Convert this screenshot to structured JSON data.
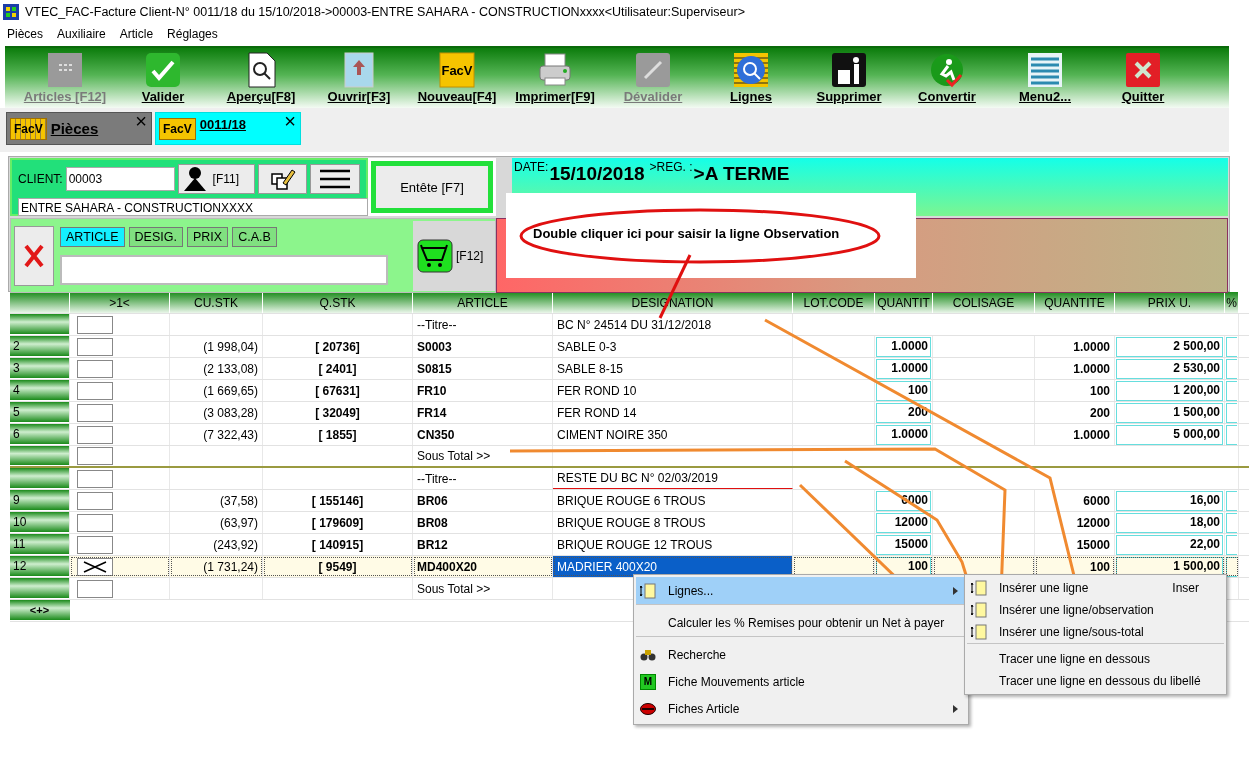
{
  "window": {
    "title": "VTEC_FAC-Facture Client-N° 0011/18 du 15/10/2018->00003-ENTRE SAHARA - CONSTRUCTIONxxxx<Utilisateur:Superviseur>"
  },
  "menu_bar": [
    "Pièces",
    "Auxiliaire",
    "Article",
    "Réglages"
  ],
  "toolbar": [
    {
      "label": "Articles [F12]",
      "disabled": true
    },
    {
      "label": "Valider",
      "disabled": false
    },
    {
      "label": "Aperçu[F8]",
      "disabled": false
    },
    {
      "label": "Ouvrir[F3]",
      "disabled": false
    },
    {
      "label": "Nouveau[F4]",
      "disabled": false,
      "icon_text": "FacV"
    },
    {
      "label": "Imprimer[F9]",
      "disabled": false
    },
    {
      "label": "Dévalider",
      "disabled": true
    },
    {
      "label": "Lignes",
      "disabled": false
    },
    {
      "label": "Supprimer",
      "disabled": false
    },
    {
      "label": "Convertir",
      "disabled": false
    },
    {
      "label": "Menu2...",
      "disabled": false
    },
    {
      "label": "Quitter",
      "disabled": false
    }
  ],
  "tabs": [
    {
      "label": "Pièces",
      "icon_text": "FacV",
      "close": "×",
      "selected": false
    },
    {
      "label": "0011/18",
      "icon_text": "FacV",
      "close": "×",
      "selected": true
    }
  ],
  "client": {
    "label": "CLIENT:",
    "code": "00003",
    "person_shortcut": "[F11]",
    "name": "ENTRE SAHARA - CONSTRUCTIONXXXX",
    "header_button": "Entête [F7]"
  },
  "search": {
    "modes": [
      {
        "label": "ARTICLE",
        "selected": true
      },
      {
        "label": "DESIG.",
        "selected": false
      },
      {
        "label": "PRIX",
        "selected": false
      },
      {
        "label": "C.A.B",
        "selected": false
      }
    ],
    "cart_shortcut": "[F12]"
  },
  "header_info": {
    "date_label": "DATE:",
    "date": "15/10/2018",
    "reg_label": ">REG. :",
    "reg": ">A TERME"
  },
  "callout": {
    "text": "Double cliquer ici pour saisir la ligne Observation"
  },
  "table": {
    "columns": [
      "",
      ">1<",
      "CU.STK",
      "Q.STK",
      "ARTICLE",
      "DESIGNATION",
      "LOT.CODE",
      "QUANTIT",
      "COLISAGE",
      "QUANTITE",
      "PRIX U.",
      "%"
    ],
    "rows": [
      {
        "kind": "title",
        "num": "",
        "article": "--Titre--",
        "designation": "BC N° 24514 DU 31/12/2018",
        "underlined": false,
        "rule_below": false,
        "selected": false
      },
      {
        "kind": "item",
        "num": "2",
        "cu_stk": "(1 998,04)",
        "q_stk": "[ 20736]",
        "article": "S0003",
        "designation": "SABLE 0-3",
        "qty": "1.0000",
        "qty2": "1.0000",
        "price": "2 500,00",
        "underlined": false,
        "rule_below": false,
        "selected": false
      },
      {
        "kind": "item",
        "num": "3",
        "cu_stk": "(2 133,08)",
        "q_stk": "[ 2401]",
        "article": "S0815",
        "designation": "SABLE 8-15",
        "qty": "1.0000",
        "qty2": "1.0000",
        "price": "2 530,00",
        "underlined": false,
        "rule_below": false,
        "selected": false
      },
      {
        "kind": "item",
        "num": "4",
        "cu_stk": "(1 669,65)",
        "q_stk": "[ 67631]",
        "article": "FR10",
        "designation": "FER ROND 10",
        "qty": "100",
        "qty2": "100",
        "price": "1 200,00",
        "underlined": false,
        "rule_below": false,
        "selected": false
      },
      {
        "kind": "item",
        "num": "5",
        "cu_stk": "(3 083,28)",
        "q_stk": "[ 32049]",
        "article": "FR14",
        "designation": "FER ROND 14",
        "qty": "200",
        "qty2": "200",
        "price": "1 500,00",
        "underlined": false,
        "rule_below": false,
        "selected": false
      },
      {
        "kind": "item",
        "num": "6",
        "cu_stk": "(7 322,43)",
        "q_stk": "[ 1855]",
        "article": "CN350",
        "designation": "CIMENT NOIRE 350",
        "qty": "1.0000",
        "qty2": "1.0000",
        "price": "5 000,00",
        "underlined": false,
        "rule_below": false,
        "selected": false
      },
      {
        "kind": "subtotal",
        "num": "",
        "article": "Sous Total >>",
        "underlined": false,
        "rule_below": true,
        "selected": false
      },
      {
        "kind": "title",
        "num": "",
        "article": "--Titre--",
        "designation": "RESTE DU BC N° 02/03/2019",
        "underlined": true,
        "rule_below": false,
        "selected": false
      },
      {
        "kind": "item",
        "num": "9",
        "cu_stk": "(37,58)",
        "q_stk": "[ 155146]",
        "article": "BR06",
        "designation": "BRIQUE ROUGE 6 TROUS",
        "qty": "6000",
        "qty2": "6000",
        "price": "16,00",
        "underlined": false,
        "rule_below": false,
        "selected": false
      },
      {
        "kind": "item",
        "num": "10",
        "cu_stk": "(63,97)",
        "q_stk": "[ 179609]",
        "article": "BR08",
        "designation": "BRIQUE ROUGE 8 TROUS",
        "qty": "12000",
        "qty2": "12000",
        "price": "18,00",
        "underlined": false,
        "rule_below": false,
        "selected": false
      },
      {
        "kind": "item",
        "num": "11",
        "cu_stk": "(243,92)",
        "q_stk": "[ 140915]",
        "article": "BR12",
        "designation": "BRIQUE ROUGE 12 TROUS",
        "qty": "15000",
        "qty2": "15000",
        "price": "22,00",
        "underlined": false,
        "rule_below": false,
        "selected": false
      },
      {
        "kind": "item",
        "num": "12",
        "cu_stk": "(1 731,24)",
        "q_stk": "[ 9549]",
        "article": "MD400X20",
        "designation": "MADRIER 400X20",
        "qty": "100",
        "qty2": "100",
        "price": "1 500,00",
        "underlined": false,
        "rule_below": false,
        "selected": true
      },
      {
        "kind": "subtotal",
        "num": "",
        "article": "Sous Total >>",
        "underlined": false,
        "rule_below": false,
        "selected": false
      }
    ],
    "footer_button": "<+>"
  },
  "context_menu": [
    {
      "label": "Lignes...",
      "has_submenu": true,
      "separator_after": true,
      "selected": true
    },
    {
      "label": "Calculer les % Remises pour obtenir un Net à payer",
      "has_submenu": false,
      "separator_after": true,
      "selected": false
    },
    {
      "label": "Recherche",
      "has_submenu": false,
      "separator_after": false,
      "selected": false
    },
    {
      "label": "Fiche Mouvements article",
      "icon_text": "M",
      "has_submenu": false,
      "separator_after": false,
      "selected": false
    },
    {
      "label": "Fiches Article",
      "has_submenu": true,
      "separator_after": false,
      "selected": false
    }
  ],
  "submenu": [
    {
      "label": "Insérer une ligne",
      "shortcut": "Inser",
      "separator_after": false
    },
    {
      "label": "Insérer une ligne/observation",
      "separator_after": false
    },
    {
      "label": "Insérer une ligne/sous-total",
      "separator_after": true
    },
    {
      "label": "Tracer une ligne en dessous",
      "separator_after": false
    },
    {
      "label": "Tracer une ligne en dessous du libellé",
      "separator_after": false
    }
  ]
}
